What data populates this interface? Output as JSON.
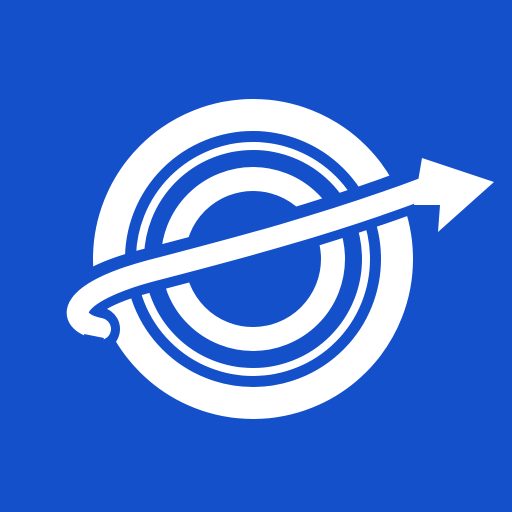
{
  "icon": {
    "name": "planet-orbit-arrow-logo",
    "background_color": "#1450CA",
    "foreground_color": "#FFFFFF"
  }
}
